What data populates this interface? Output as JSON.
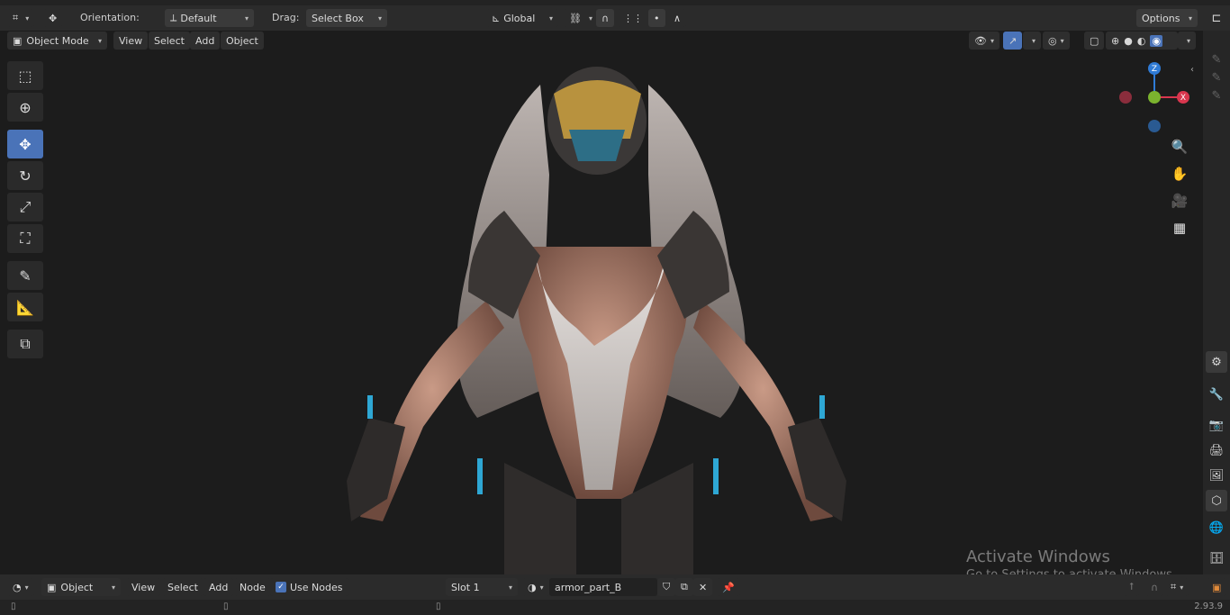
{
  "header": {
    "orientation_label": "Orientation:",
    "orientation_value": "Default",
    "drag_label": "Drag:",
    "drag_value": "Select Box",
    "transform_space": "Global",
    "options_label": "Options"
  },
  "viewport_header": {
    "mode": "Object Mode",
    "menu": [
      "View",
      "Select",
      "Add",
      "Object"
    ]
  },
  "shader_header": {
    "type": "Object",
    "menu": [
      "View",
      "Select",
      "Add",
      "Node"
    ],
    "use_nodes_label": "Use Nodes",
    "use_nodes_checked": true,
    "slot": "Slot 1",
    "material_name": "armor_part_B"
  },
  "gizmo": {
    "z_label": "Z",
    "x_label": "X",
    "colors": {
      "z": "#2f7bd6",
      "x": "#d9364e",
      "y": "#7bb32e"
    }
  },
  "watermark": {
    "title": "Activate Windows",
    "subtitle": "Go to Settings to activate Windows."
  },
  "statusbar": {
    "version": "2.93.9"
  },
  "colors": {
    "accent": "#4a73b8",
    "header_bg": "#2b2b2b",
    "viewport_bg": "#1c1c1c"
  },
  "icons": {
    "toolbar": [
      "select-box-icon",
      "cursor-icon",
      "move-icon",
      "rotate-icon",
      "scale-icon",
      "transform-icon",
      "annotate-icon",
      "measure-icon",
      "add-cube-icon"
    ],
    "navigation": [
      "zoom-icon",
      "pan-hand-icon",
      "camera-icon",
      "grid-icon"
    ],
    "properties": [
      "tool-icon",
      "render-icon",
      "output-icon",
      "view-layer-icon",
      "scene-icon",
      "world-icon",
      "collection-icon",
      "object-icon"
    ]
  }
}
